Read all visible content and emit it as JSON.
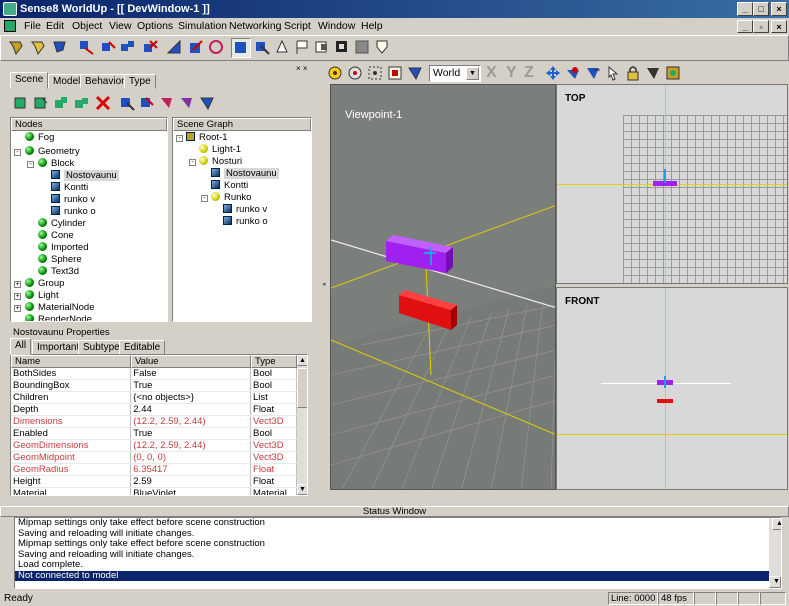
{
  "window": {
    "title": "Sense8 WorldUp - [[ DevWindow-1 ]]"
  },
  "menu": [
    "File",
    "Edit",
    "Object",
    "View",
    "Options",
    "Simulation",
    "Networking",
    "Script",
    "Window",
    "Help"
  ],
  "left_tabs": [
    "Scene",
    "Model",
    "Behavior",
    "Type"
  ],
  "nodes_panel": {
    "header": "Nodes",
    "items": [
      "Fog",
      "Geometry",
      "Block",
      "Nostovaunu",
      "Kontti",
      "runko v",
      "runko o",
      "Cylinder",
      "Cone",
      "Imported",
      "Sphere",
      "Text3d",
      "Group",
      "Light",
      "MaterialNode",
      "RenderNode"
    ]
  },
  "scene_graph": {
    "header": "Scene Graph",
    "items": [
      "Root-1",
      "Light-1",
      "Nosturi",
      "Nostovaunu",
      "Kontti",
      "Runko",
      "runko v",
      "runko o"
    ]
  },
  "properties": {
    "title": "Nostovaunu Properties",
    "tabs": [
      "All",
      "Important",
      "Subtype",
      "Editable"
    ],
    "columns": [
      "Name",
      "Value",
      "Type"
    ],
    "rows": [
      {
        "name": "BothSides",
        "value": "False",
        "type": "Bool"
      },
      {
        "name": "BoundingBox",
        "value": "True",
        "type": "Bool"
      },
      {
        "name": "Children",
        "value": "{<no objects>}",
        "type": "List"
      },
      {
        "name": "Depth",
        "value": "2.44",
        "type": "Float"
      },
      {
        "name": "Dimensions",
        "value": "(12.2, 2.59, 2.44)",
        "type": "Vect3D"
      },
      {
        "name": "Enabled",
        "value": "True",
        "type": "Bool"
      },
      {
        "name": "GeomDimensions",
        "value": "(12.2, 2.59, 2.44)",
        "type": "Vect3D"
      },
      {
        "name": "GeomMidpoint",
        "value": "(0, 0, 0)",
        "type": "Vect3D"
      },
      {
        "name": "GeomRadius",
        "value": "6.35417",
        "type": "Float"
      },
      {
        "name": "Height",
        "value": "2.59",
        "type": "Float"
      },
      {
        "name": "Material",
        "value": "BlueViolet",
        "type": "Material"
      }
    ]
  },
  "viewport_toolbar": {
    "coord_select": "World",
    "axes": [
      "X",
      "Y",
      "Z"
    ]
  },
  "views": {
    "perspective": "Viewpoint-1",
    "top": "TOP",
    "front": "FRONT"
  },
  "status_window": {
    "title": "Status Window",
    "lines": [
      "Mipmap settings only take effect before scene construction",
      "Saving and reloading will initiate changes.",
      "Mipmap settings only take effect before scene construction",
      "Saving and reloading will initiate changes.",
      "Load complete.",
      "Not connected to model"
    ]
  },
  "statusbar": {
    "left": "Ready",
    "line": "Line: 0000",
    "fps": "48 fps"
  },
  "colors": {
    "selected": "#0a246a",
    "purple_object": "#a020f0",
    "red_object": "#e01010",
    "axis_line": "#e0d000"
  }
}
